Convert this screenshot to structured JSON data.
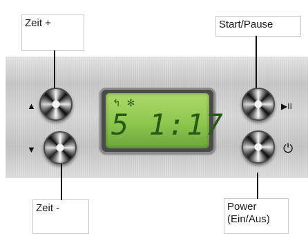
{
  "labels": {
    "time_up": "Zeit +",
    "time_down": "Zeit -",
    "start_pause": "Start/Pause",
    "power_line1": "Power",
    "power_line2": "(Ein/Aus)"
  },
  "buttons": {
    "up_glyph": "▲",
    "down_glyph": "▼",
    "play_pause_glyph": "▶II",
    "power_glyph": "⏻"
  },
  "display": {
    "icon_1": "↰",
    "icon_2": "✻",
    "time": "5 1:17"
  },
  "colors": {
    "panel": "#d4d4d4",
    "lcd": "#9ccf5a",
    "lcd_text": "#2a5a18"
  },
  "icons": [
    "up-triangle-icon",
    "down-triangle-icon",
    "play-pause-icon",
    "power-icon",
    "steam-icon",
    "snowflake-icon"
  ]
}
